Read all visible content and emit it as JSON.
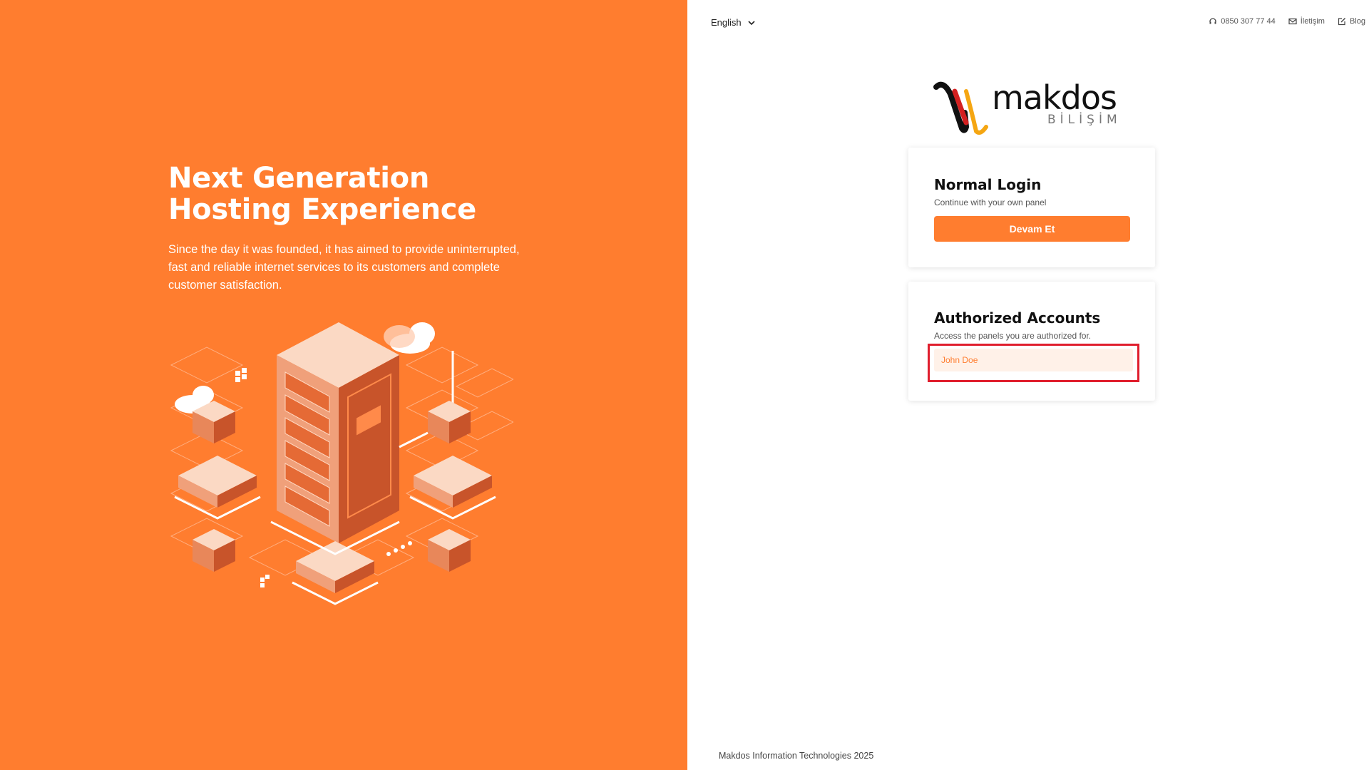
{
  "hero": {
    "title_line1": "Next Generation",
    "title_line2": "Hosting Experience",
    "description": "Since the day it was founded, it has aimed to provide uninterrupted, fast and reliable internet services to its customers and complete customer satisfaction."
  },
  "header": {
    "language": "English",
    "phone": "0850 307 77 44",
    "contact": "İletişim",
    "blog": "Blog"
  },
  "logo": {
    "name": "makdos",
    "subtitle": "BİLİŞİM"
  },
  "normal_login": {
    "title": "Normal Login",
    "subtitle": "Continue with your own panel",
    "button": "Devam Et"
  },
  "authorized_accounts": {
    "title": "Authorized Accounts",
    "subtitle": "Access the panels you are authorized for.",
    "accounts": [
      "John Doe"
    ]
  },
  "footer": {
    "text": "Makdos Information Technologies 2025"
  },
  "colors": {
    "accent": "#ff7d2f",
    "highlight": "#e01e2d"
  }
}
